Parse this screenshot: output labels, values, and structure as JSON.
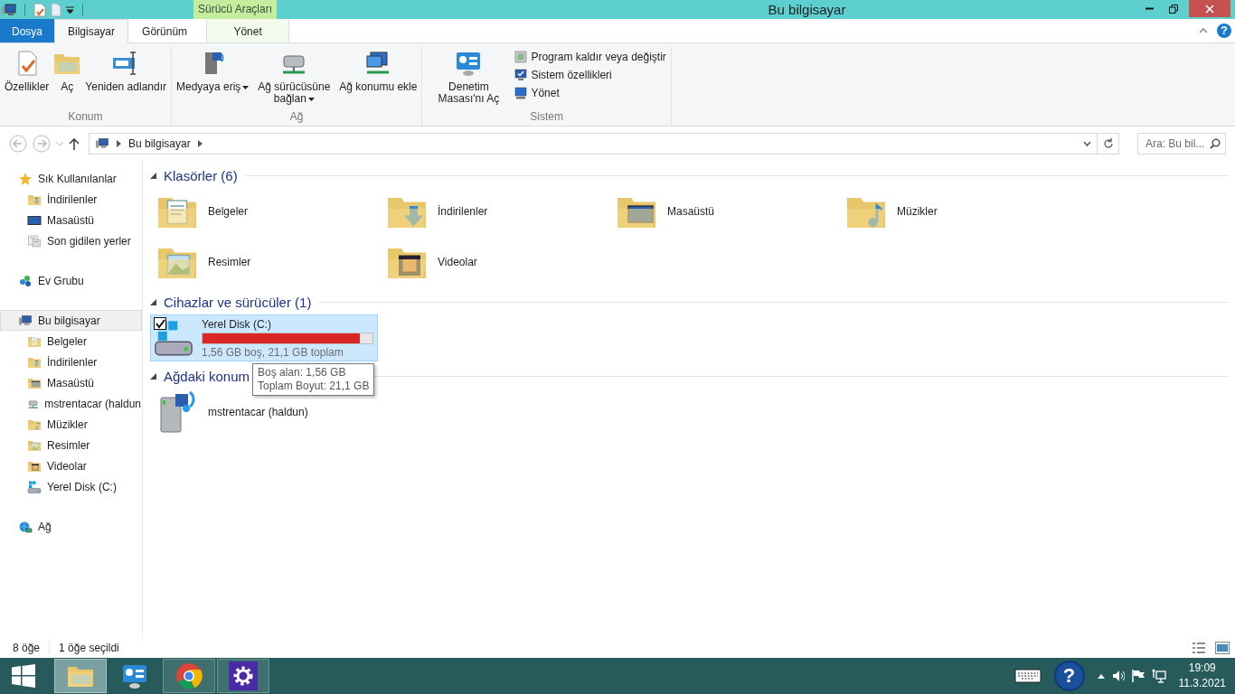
{
  "window": {
    "title": "Bu bilgisayar"
  },
  "contextual": {
    "group": "Sürücü Araçları",
    "tab": "Yönet",
    "selected": false
  },
  "ribbon_tabs": [
    {
      "label": "Dosya",
      "kind": "file",
      "selected": false
    },
    {
      "label": "Bilgisayar",
      "kind": "tab",
      "selected": true
    },
    {
      "label": "Görünüm",
      "kind": "tab",
      "selected": false
    }
  ],
  "help_mark": "?",
  "ribbon_groups": [
    {
      "label": "Konum",
      "buttons": [
        {
          "label": "Özellikler",
          "kind": "large",
          "dropdown": false
        },
        {
          "label": "Aç",
          "kind": "large",
          "dropdown": false
        },
        {
          "label": "Yeniden adlandır",
          "kind": "large",
          "dropdown": false
        }
      ]
    },
    {
      "label": "Ağ",
      "buttons": [
        {
          "label": "Medyaya eriş",
          "kind": "large",
          "dropdown": true
        },
        {
          "label": "Ağ sürücüsüne bağlan",
          "kind": "large",
          "dropdown": true
        },
        {
          "label": "Ağ konumu ekle",
          "kind": "large",
          "dropdown": false
        }
      ]
    },
    {
      "label": "Sistem",
      "buttons": [
        {
          "label": "Denetim Masası'nı Aç",
          "kind": "large",
          "dropdown": false
        },
        {
          "label": "Program kaldır veya değiştir",
          "kind": "small"
        },
        {
          "label": "Sistem özellikleri",
          "kind": "small"
        },
        {
          "label": "Yönet",
          "kind": "small"
        }
      ]
    }
  ],
  "address": {
    "crumbs": [
      "Bu bilgisayar"
    ],
    "search_placeholder": "Ara: Bu bil..."
  },
  "sidebar": [
    {
      "label": "Sık Kullanılanlar",
      "kind": "star",
      "selected": false,
      "children": [
        {
          "label": "İndirilenler",
          "kind": "downloads",
          "selected": false
        },
        {
          "label": "Masaüstü",
          "kind": "desktop",
          "selected": false
        },
        {
          "label": "Son gidilen yerler",
          "kind": "recent",
          "selected": false
        }
      ]
    },
    {
      "label": "Ev Grubu",
      "kind": "homegroup",
      "selected": false
    },
    {
      "label": "Bu bilgisayar",
      "kind": "computer",
      "selected": true,
      "children": [
        {
          "label": "Belgeler",
          "kind": "documents",
          "selected": false
        },
        {
          "label": "İndirilenler",
          "kind": "downloads",
          "selected": false
        },
        {
          "label": "Masaüstü",
          "kind": "desktopfolder",
          "selected": false
        },
        {
          "label": "mstrentacar (haldun",
          "kind": "netdrive",
          "selected": false
        },
        {
          "label": "Müzikler",
          "kind": "music",
          "selected": false
        },
        {
          "label": "Resimler",
          "kind": "pictures",
          "selected": false
        },
        {
          "label": "Videolar",
          "kind": "videos",
          "selected": false
        },
        {
          "label": "Yerel Disk (C:)",
          "kind": "drive",
          "selected": false
        }
      ]
    },
    {
      "label": "Ağ",
      "kind": "network",
      "selected": false
    }
  ],
  "sections": [
    {
      "heading": "Klasörler (6)",
      "kind": "folders",
      "items": [
        {
          "name": "Belgeler",
          "kind": "documents"
        },
        {
          "name": "İndirilenler",
          "kind": "downloads"
        },
        {
          "name": "Masaüstü",
          "kind": "desktopfolder"
        },
        {
          "name": "Müzikler",
          "kind": "music"
        },
        {
          "name": "Resimler",
          "kind": "pictures"
        },
        {
          "name": "Videolar",
          "kind": "videos"
        }
      ]
    },
    {
      "heading": "Cihazlar ve sürücüler (1)",
      "kind": "drives",
      "items": [
        {
          "name": "Yerel Disk (C:)",
          "detail": "1,56 GB boş, 21,1 GB toplam",
          "level": 0.926,
          "selected": true,
          "checked": true
        }
      ]
    },
    {
      "heading": "Ağdaki konum",
      "kind": "network",
      "items": [
        {
          "name": "mstrentacar (haldun)"
        }
      ]
    }
  ],
  "tooltip": {
    "lines": [
      "Boş alan: 1,56 GB",
      "Toplam Boyut: 21,1 GB"
    ]
  },
  "status_bar": {
    "count": "8 öğe",
    "selection": "1 öğe seçildi"
  },
  "taskbar": {
    "apps": [
      {
        "kind": "explorer",
        "selected": true,
        "running": true
      },
      {
        "kind": "controlpanel",
        "selected": false,
        "running": false
      },
      {
        "kind": "chrome",
        "selected": false,
        "running": true
      },
      {
        "kind": "settings",
        "selected": false,
        "running": true
      }
    ],
    "help_mark": "?",
    "time": "19:09",
    "date": "11.3.2021"
  }
}
